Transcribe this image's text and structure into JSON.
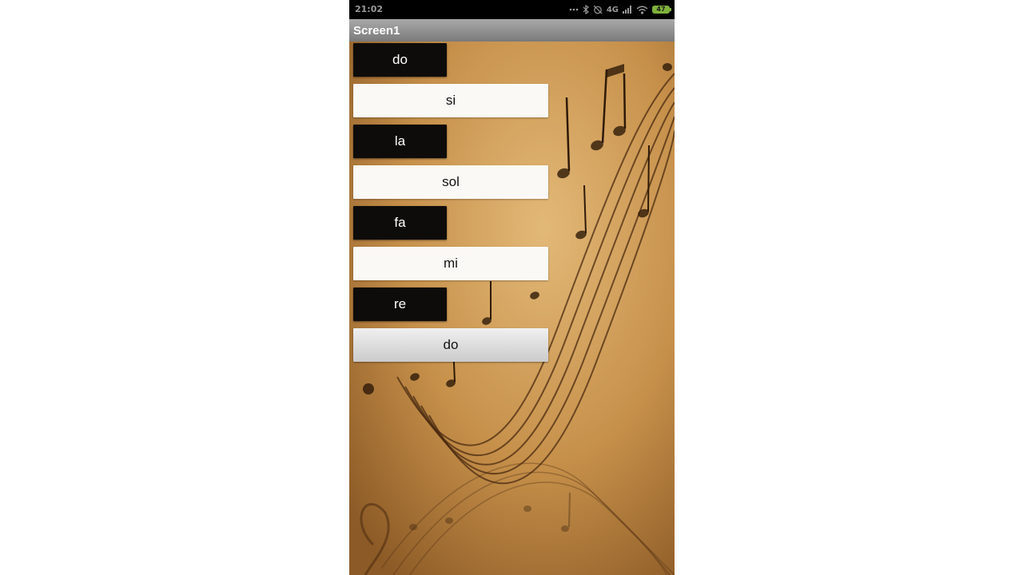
{
  "status_bar": {
    "time": "21:02",
    "network": "4G",
    "battery": "47",
    "icons": [
      "more-dots-icon",
      "bluetooth-icon",
      "alarm-off-icon",
      "signal-icon",
      "wifi-icon",
      "battery-icon"
    ]
  },
  "title_bar": {
    "title": "Screen1"
  },
  "buttons": [
    {
      "label": "do",
      "style": "dark"
    },
    {
      "label": "si",
      "style": "light"
    },
    {
      "label": "la",
      "style": "dark"
    },
    {
      "label": "sol",
      "style": "light"
    },
    {
      "label": "fa",
      "style": "dark"
    },
    {
      "label": "mi",
      "style": "light"
    },
    {
      "label": "re",
      "style": "dark"
    },
    {
      "label": "do",
      "style": "pressed"
    }
  ],
  "colors": {
    "background": "#c08a45",
    "dark_button": "#0e0c0a",
    "light_button": "#fbf9f6",
    "title_bar": "#8e8e8e",
    "status_bar": "#000000",
    "battery": "#7fb13b"
  }
}
